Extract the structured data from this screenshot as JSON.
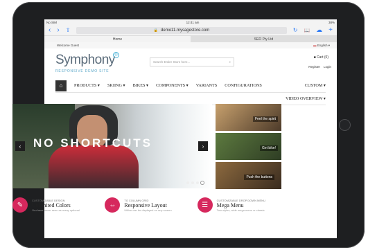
{
  "status": {
    "carrier": "No SIM",
    "time": "12:41 am",
    "battery": "38%"
  },
  "browser": {
    "back": "‹",
    "forward": "›",
    "share": "⇪",
    "url": "demo11.mysagestore.com",
    "lock": "🔒",
    "reload": "↻",
    "bookmarks": "📖",
    "cloud": "☁",
    "new_tab": "+",
    "tabs": [
      "Home",
      "SEO Pty Ltd"
    ]
  },
  "site": {
    "welcome": "Welcome Guest",
    "language": "English",
    "logo": "Symphony",
    "logo_mark": "®",
    "logo_tag": "RESPONSIVE DEMO SITE",
    "search_placeholder": "Search Entire Store here...",
    "cart": "Cart (0)",
    "register": "Register",
    "login": "Login",
    "nav": [
      "PRODUCTS",
      "SKIING",
      "BIKES",
      "COMPONENTS",
      "VARIANTS",
      "CONFIGURATIONS",
      "CUSTOM"
    ],
    "nav_second": "VIDEO OVERVIEW"
  },
  "hero": {
    "text": "NO SHORTCUTS",
    "prev": "‹",
    "next": "›",
    "slides": 4,
    "active_slide": 4
  },
  "side_banners": [
    "Feel the spirit",
    "Get bike!",
    "Push the buttons"
  ],
  "features": [
    {
      "small": "CUSTOMIZABLE DESIGN",
      "title": "Unlimited Colors",
      "desc": "You have never seen as many optional",
      "icon": "brush-icon"
    },
    {
      "small": "TO COLUMN GRID",
      "title": "Responsive Layout",
      "desc": "Utilize can be displayed on any screen",
      "icon": "responsive-icon"
    },
    {
      "small": "CUSTOMIZABLE DROP DOWN MENU",
      "title": "Mega Menu",
      "desc": "Two styles, wide mega menu or classic",
      "icon": "menu-icon"
    }
  ]
}
